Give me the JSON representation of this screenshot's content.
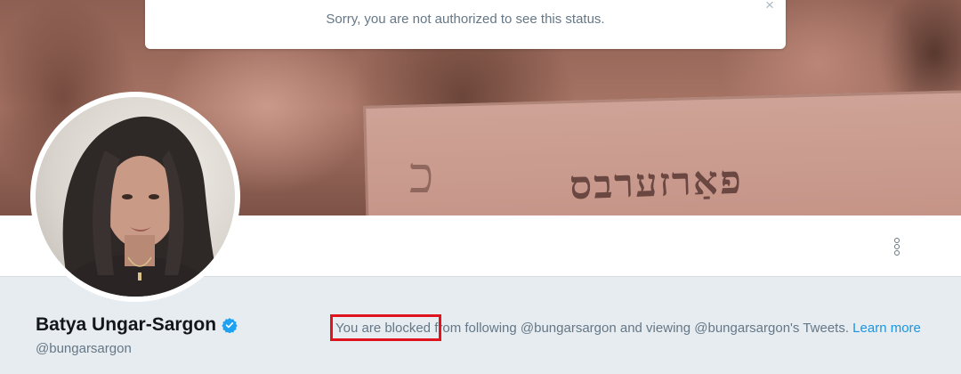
{
  "toast": {
    "message": "Sorry, you are not authorized to see this status.",
    "close_symbol": "×"
  },
  "banner": {
    "sign_text": "פאַרזערבס"
  },
  "profile": {
    "name": "Batya Ungar-Sargon",
    "handle": "@bungarsargon",
    "verified": true
  },
  "blocked_message": {
    "highlight": "You are blocked",
    "text": " from following @bungarsargon and viewing @bungarsargon's Tweets. ",
    "link": "Learn more"
  },
  "colors": {
    "verified_badge": "#1da1f2",
    "highlight_box": "#e0141f",
    "link": "#1b95e0",
    "page_background": "#e6ecf0"
  },
  "icons": {
    "more": "more-vertical-icon",
    "close": "close-icon",
    "verified": "verified-badge-icon"
  }
}
